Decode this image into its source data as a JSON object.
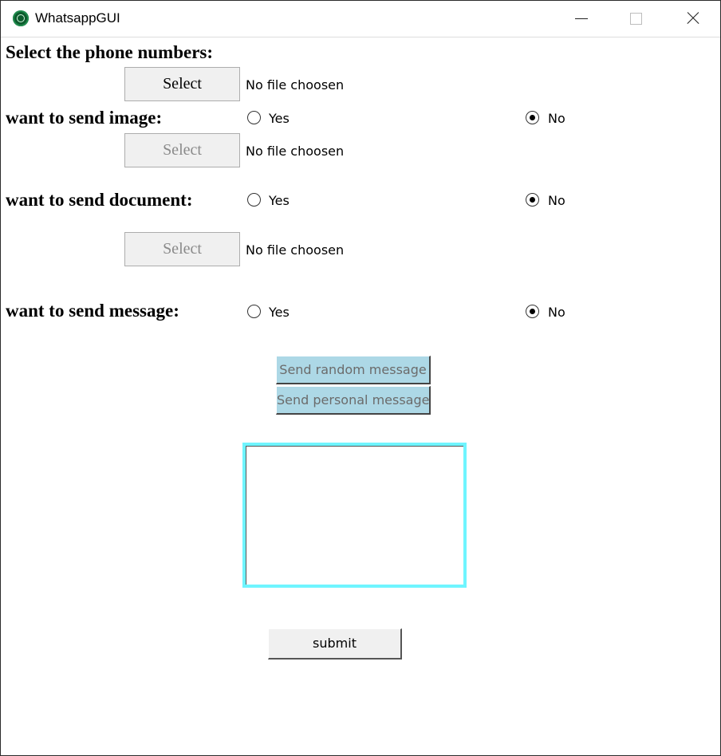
{
  "window": {
    "title": "WhatsappGUI"
  },
  "phone": {
    "label": "Select the phone numbers:",
    "select_label": "Select",
    "file_status": "No file choosen"
  },
  "image": {
    "label": "want to send image:",
    "yes_label": "Yes",
    "no_label": "No",
    "selected": "No",
    "select_label": "Select",
    "file_status": "No file choosen"
  },
  "document": {
    "label": "want to send document:",
    "yes_label": "Yes",
    "no_label": "No",
    "selected": "No",
    "select_label": "Select",
    "file_status": "No file choosen"
  },
  "message": {
    "label": "want to send message:",
    "yes_label": "Yes",
    "no_label": "No",
    "selected": "No",
    "random_button": "Send random message",
    "personal_button": "Send personal message",
    "text_value": ""
  },
  "submit_label": "submit",
  "colors": {
    "message_buttons": "#add8e6",
    "textbox_border": "#6ff5ff"
  }
}
